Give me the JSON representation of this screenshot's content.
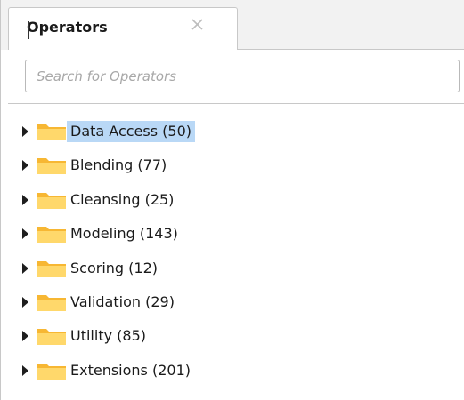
{
  "tab": {
    "title": "Operators",
    "close_icon": "close-icon"
  },
  "search": {
    "placeholder": "Search for Operators",
    "value": ""
  },
  "tree": {
    "items": [
      {
        "label": "Data Access (50)",
        "selected": true,
        "icon": "folder-icon",
        "expander": "expand-arrow-icon"
      },
      {
        "label": "Blending (77)",
        "selected": false,
        "icon": "folder-icon",
        "expander": "expand-arrow-icon"
      },
      {
        "label": "Cleansing (25)",
        "selected": false,
        "icon": "folder-icon",
        "expander": "expand-arrow-icon"
      },
      {
        "label": "Modeling (143)",
        "selected": false,
        "icon": "folder-icon",
        "expander": "expand-arrow-icon"
      },
      {
        "label": "Scoring (12)",
        "selected": false,
        "icon": "folder-icon",
        "expander": "expand-arrow-icon"
      },
      {
        "label": "Validation (29)",
        "selected": false,
        "icon": "folder-icon",
        "expander": "expand-arrow-icon"
      },
      {
        "label": "Utility (85)",
        "selected": false,
        "icon": "folder-icon",
        "expander": "expand-arrow-icon"
      },
      {
        "label": "Extensions (201)",
        "selected": false,
        "icon": "folder-icon",
        "expander": "expand-arrow-icon"
      }
    ]
  },
  "colors": {
    "selection": "#b9d8f6",
    "folder": "#f7b733",
    "folder_light": "#ffd86b",
    "border": "#c8c8c8"
  }
}
